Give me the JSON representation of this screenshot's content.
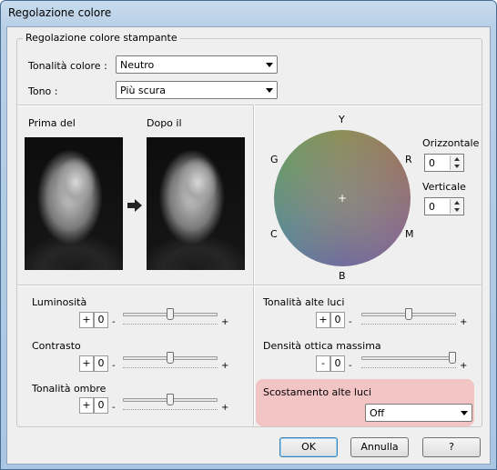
{
  "window": {
    "title": "Regolazione colore"
  },
  "group": {
    "title": "Regolazione colore stampante"
  },
  "color_tone": {
    "label": "Tonalità colore :",
    "value": "Neutro"
  },
  "tone": {
    "label": "Tono :",
    "value": "Più scura"
  },
  "preview": {
    "before_label": "Prima del",
    "after_label": "Dopo il"
  },
  "wheel": {
    "labels": {
      "Y": "Y",
      "R": "R",
      "M": "M",
      "B": "B",
      "C": "C",
      "G": "G"
    },
    "center_marker": "+"
  },
  "horizontal": {
    "label": "Orizzontale",
    "value": "0"
  },
  "vertical": {
    "label": "Verticale",
    "value": "0"
  },
  "sliders": {
    "brightness": {
      "label": "Luminosità",
      "sign": "+",
      "value": "0",
      "min_glyph": "-",
      "max_glyph": "+",
      "position": 0.5
    },
    "contrast": {
      "label": "Contrasto",
      "sign": "+",
      "value": "0",
      "min_glyph": "-",
      "max_glyph": "+",
      "position": 0.5
    },
    "shadow_tone": {
      "label": "Tonalità ombre",
      "sign": "+",
      "value": "0",
      "min_glyph": "-",
      "max_glyph": "+",
      "position": 0.5
    },
    "highlight_tone": {
      "label": "Tonalità alte luci",
      "sign": "+",
      "value": "0",
      "min_glyph": "-",
      "max_glyph": "+",
      "position": 0.5
    },
    "max_density": {
      "label": "Densità ottica massima",
      "sign": "-",
      "value": "0",
      "min_glyph": "-",
      "max_glyph": "+",
      "position": 1.0
    }
  },
  "highlight_shift": {
    "label": "Scostamento alte luci",
    "value": "Off"
  },
  "buttons": {
    "ok": "OK",
    "cancel": "Annulla",
    "help": "?"
  },
  "colors": {
    "highlight_panel": "#f3c4c4",
    "default_button_border": "#3c7fb1"
  }
}
